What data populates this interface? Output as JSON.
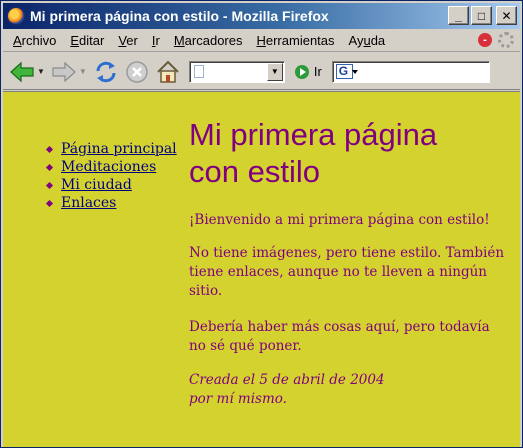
{
  "window": {
    "title": "Mi primera página con estilo - Mozilla Firefox",
    "controls": {
      "minimize": "_",
      "maximize": "□",
      "close": "✕"
    }
  },
  "menubar": {
    "items": [
      {
        "label": "Archivo",
        "accel": "A",
        "rest": "rchivo"
      },
      {
        "label": "Editar",
        "accel": "E",
        "rest": "ditar"
      },
      {
        "label": "Ver",
        "accel": "V",
        "rest": "er"
      },
      {
        "label": "Ir",
        "accel": "I",
        "rest": "r"
      },
      {
        "label": "Marcadores",
        "accel": "M",
        "rest": "arcadores"
      },
      {
        "label": "Herramientas",
        "accel": "H",
        "rest": "erramientas"
      },
      {
        "label": "Ayuda",
        "pre": "Ay",
        "accel": "u",
        "rest": "da"
      }
    ]
  },
  "toolbar": {
    "icons": [
      "back-arrow-icon",
      "forward-arrow-icon",
      "reload-icon",
      "stop-icon",
      "home-icon"
    ],
    "url_value": "",
    "go_label": "Ir",
    "search_value": "",
    "search_engine_icon": "google-icon"
  },
  "colors": {
    "page_background": "#d4d22f",
    "text": "#800080",
    "link": "#000080",
    "titlebar_start": "#0a246a",
    "titlebar_end": "#a6caf0"
  },
  "page": {
    "nav": [
      "Página principal",
      "Meditaciones",
      "Mi ciudad",
      "Enlaces"
    ],
    "title_line1": "Mi primera página",
    "title_line2": "con estilo",
    "paragraphs": [
      "¡Bienvenido a mi primera página con estilo!",
      "No tiene imágenes, pero tiene estilo. También tiene enlaces, aunque no te lleven a ningún sitio.",
      "Debería haber más cosas aquí, pero todavía no sé qué poner."
    ],
    "signature_line1": "Creada el 5 de abril de 2004",
    "signature_line2": "por mí mismo."
  }
}
